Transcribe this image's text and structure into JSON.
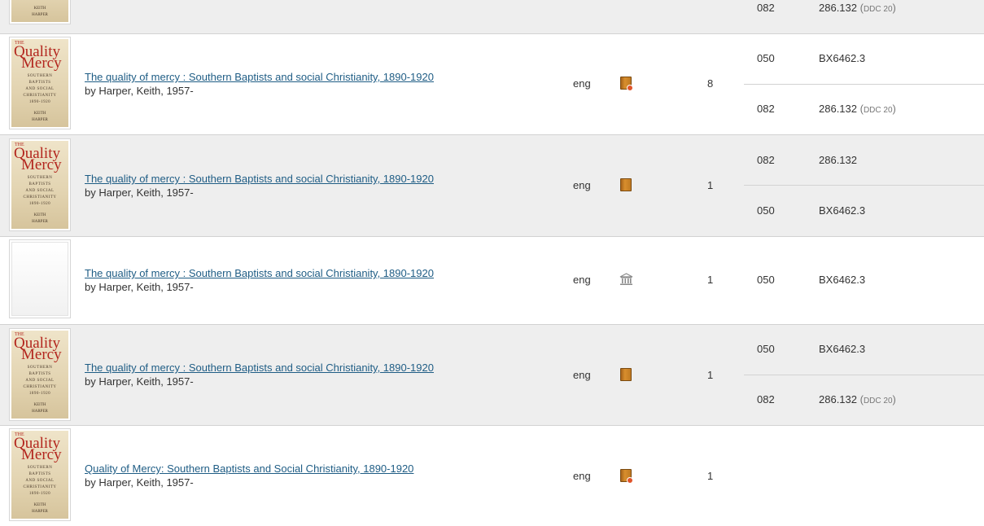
{
  "rows": [
    {
      "class_entries": [
        {
          "code": "082",
          "value": "286.132",
          "ddc_open": " (",
          "ddc": "DDC 20",
          "ddc_close": ")"
        }
      ]
    },
    {
      "title": "The quality of mercy : Southern Baptists and social Christianity, 1890-1920",
      "author": "by Harper, Keith, 1957-",
      "language": "eng",
      "format_icon": "ebook-icon",
      "count": "8",
      "class_entries": [
        {
          "code": "050",
          "value": "BX6462.3"
        },
        {
          "code": "082",
          "value": "286.132",
          "ddc_open": " (",
          "ddc": "DDC 20",
          "ddc_close": ")"
        }
      ]
    },
    {
      "title": "The quality of mercy : Southern Baptists and social Christianity, 1890-1920",
      "author": "by Harper, Keith, 1957-",
      "language": "eng",
      "format_icon": "book-icon",
      "count": "1",
      "class_entries": [
        {
          "code": "082",
          "value": "286.132"
        },
        {
          "code": "050",
          "value": "BX6462.3"
        }
      ]
    },
    {
      "title": "The quality of mercy : Southern Baptists and social Christianity, 1890-1920",
      "author": "by Harper, Keith, 1957-",
      "language": "eng",
      "format_icon": "archive-material-icon",
      "count": "1",
      "class_entries": [
        {
          "code": "050",
          "value": "BX6462.3"
        }
      ]
    },
    {
      "title": "The quality of mercy : Southern Baptists and social Christianity, 1890-1920",
      "author": "by Harper, Keith, 1957-",
      "language": "eng",
      "format_icon": "book-icon",
      "count": "1",
      "class_entries": [
        {
          "code": "050",
          "value": "BX6462.3"
        },
        {
          "code": "082",
          "value": "286.132",
          "ddc_open": " (",
          "ddc": "DDC 20",
          "ddc_close": ")"
        }
      ]
    },
    {
      "title": "Quality of Mercy: Southern Baptists and Social Christianity, 1890-1920",
      "author": "by Harper, Keith, 1957-",
      "language": "eng",
      "format_icon": "ebook-icon",
      "count": "1",
      "class_entries": []
    }
  ],
  "cover_art": {
    "the": "THE",
    "q": "Quality",
    "of": "OF",
    "m": "Mercy",
    "subtitle_lines": [
      "SOUTHERN",
      "BAPTISTS",
      "AND SOCIAL",
      "CHRISTIANITY",
      "1890-1920"
    ],
    "author_lines": [
      "KEITH",
      "HARPER"
    ]
  },
  "colors": {
    "link": "#1f5d85",
    "row_alt": "#eeeeee",
    "border": "#d2d2d2"
  }
}
